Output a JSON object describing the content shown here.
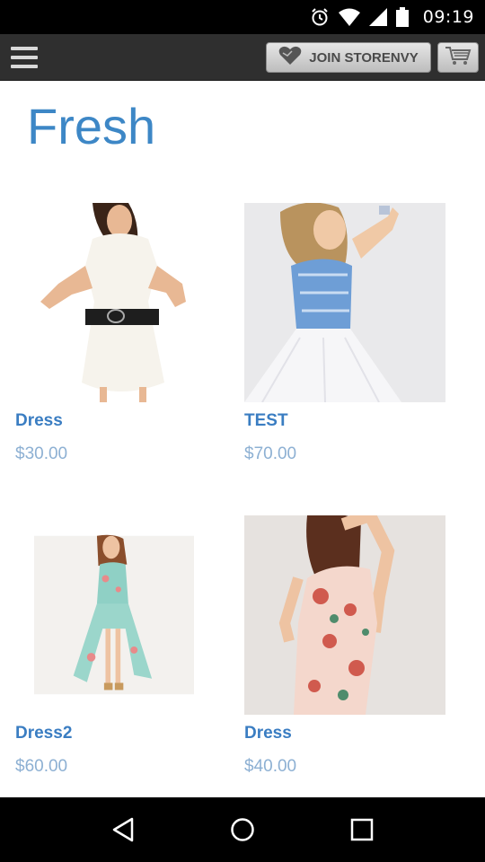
{
  "status_bar": {
    "time": "09:19",
    "icons": [
      "alarm-icon",
      "wifi-icon",
      "signal-icon",
      "battery-icon"
    ]
  },
  "app_bar": {
    "menu_icon": "hamburger-menu-icon",
    "join_label": "JOIN STORENVY",
    "join_icon": "heart-icon",
    "cart_icon": "cart-icon"
  },
  "main": {
    "title": "Fresh",
    "products": [
      {
        "name": "Dress",
        "price": "$30.00",
        "image": "white-knit-dress-photo"
      },
      {
        "name": "TEST",
        "price": "$70.00",
        "image": "blue-sequin-strapless-dress-photo"
      },
      {
        "name": "Dress2",
        "price": "$60.00",
        "image": "floral-high-low-dress-photo"
      },
      {
        "name": "Dress",
        "price": "$40.00",
        "image": "floral-sleeveless-dress-photo"
      }
    ]
  },
  "nav_bar": {
    "icons": [
      "back-icon",
      "home-icon",
      "recents-icon"
    ]
  },
  "colors": {
    "accent": "#3d87c6",
    "product_name": "#3a7dc2",
    "price": "#8db0d3",
    "app_bar": "#2f2f2f"
  }
}
